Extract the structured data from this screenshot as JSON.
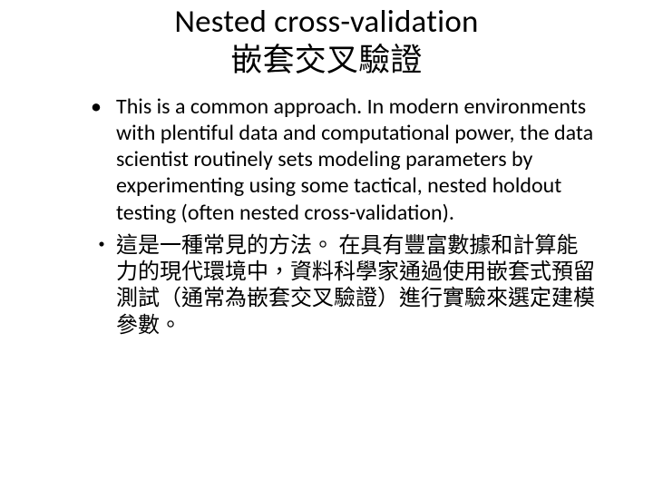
{
  "title": {
    "line1": "Nested cross-validation",
    "line2": "嵌套交叉驗證"
  },
  "bullets": [
    "This is a common approach. In modern environments with plentiful data and computational power, the data scientist routinely sets modeling parameters by experimenting using some tactical, nested holdout testing (often nested cross-validation).",
    "這是一種常見的方法。 在具有豐富數據和計算能力的現代環境中，資料科學家通過使用嵌套式預留測試（通常為嵌套交叉驗證）進行實驗來選定建模參數。"
  ]
}
